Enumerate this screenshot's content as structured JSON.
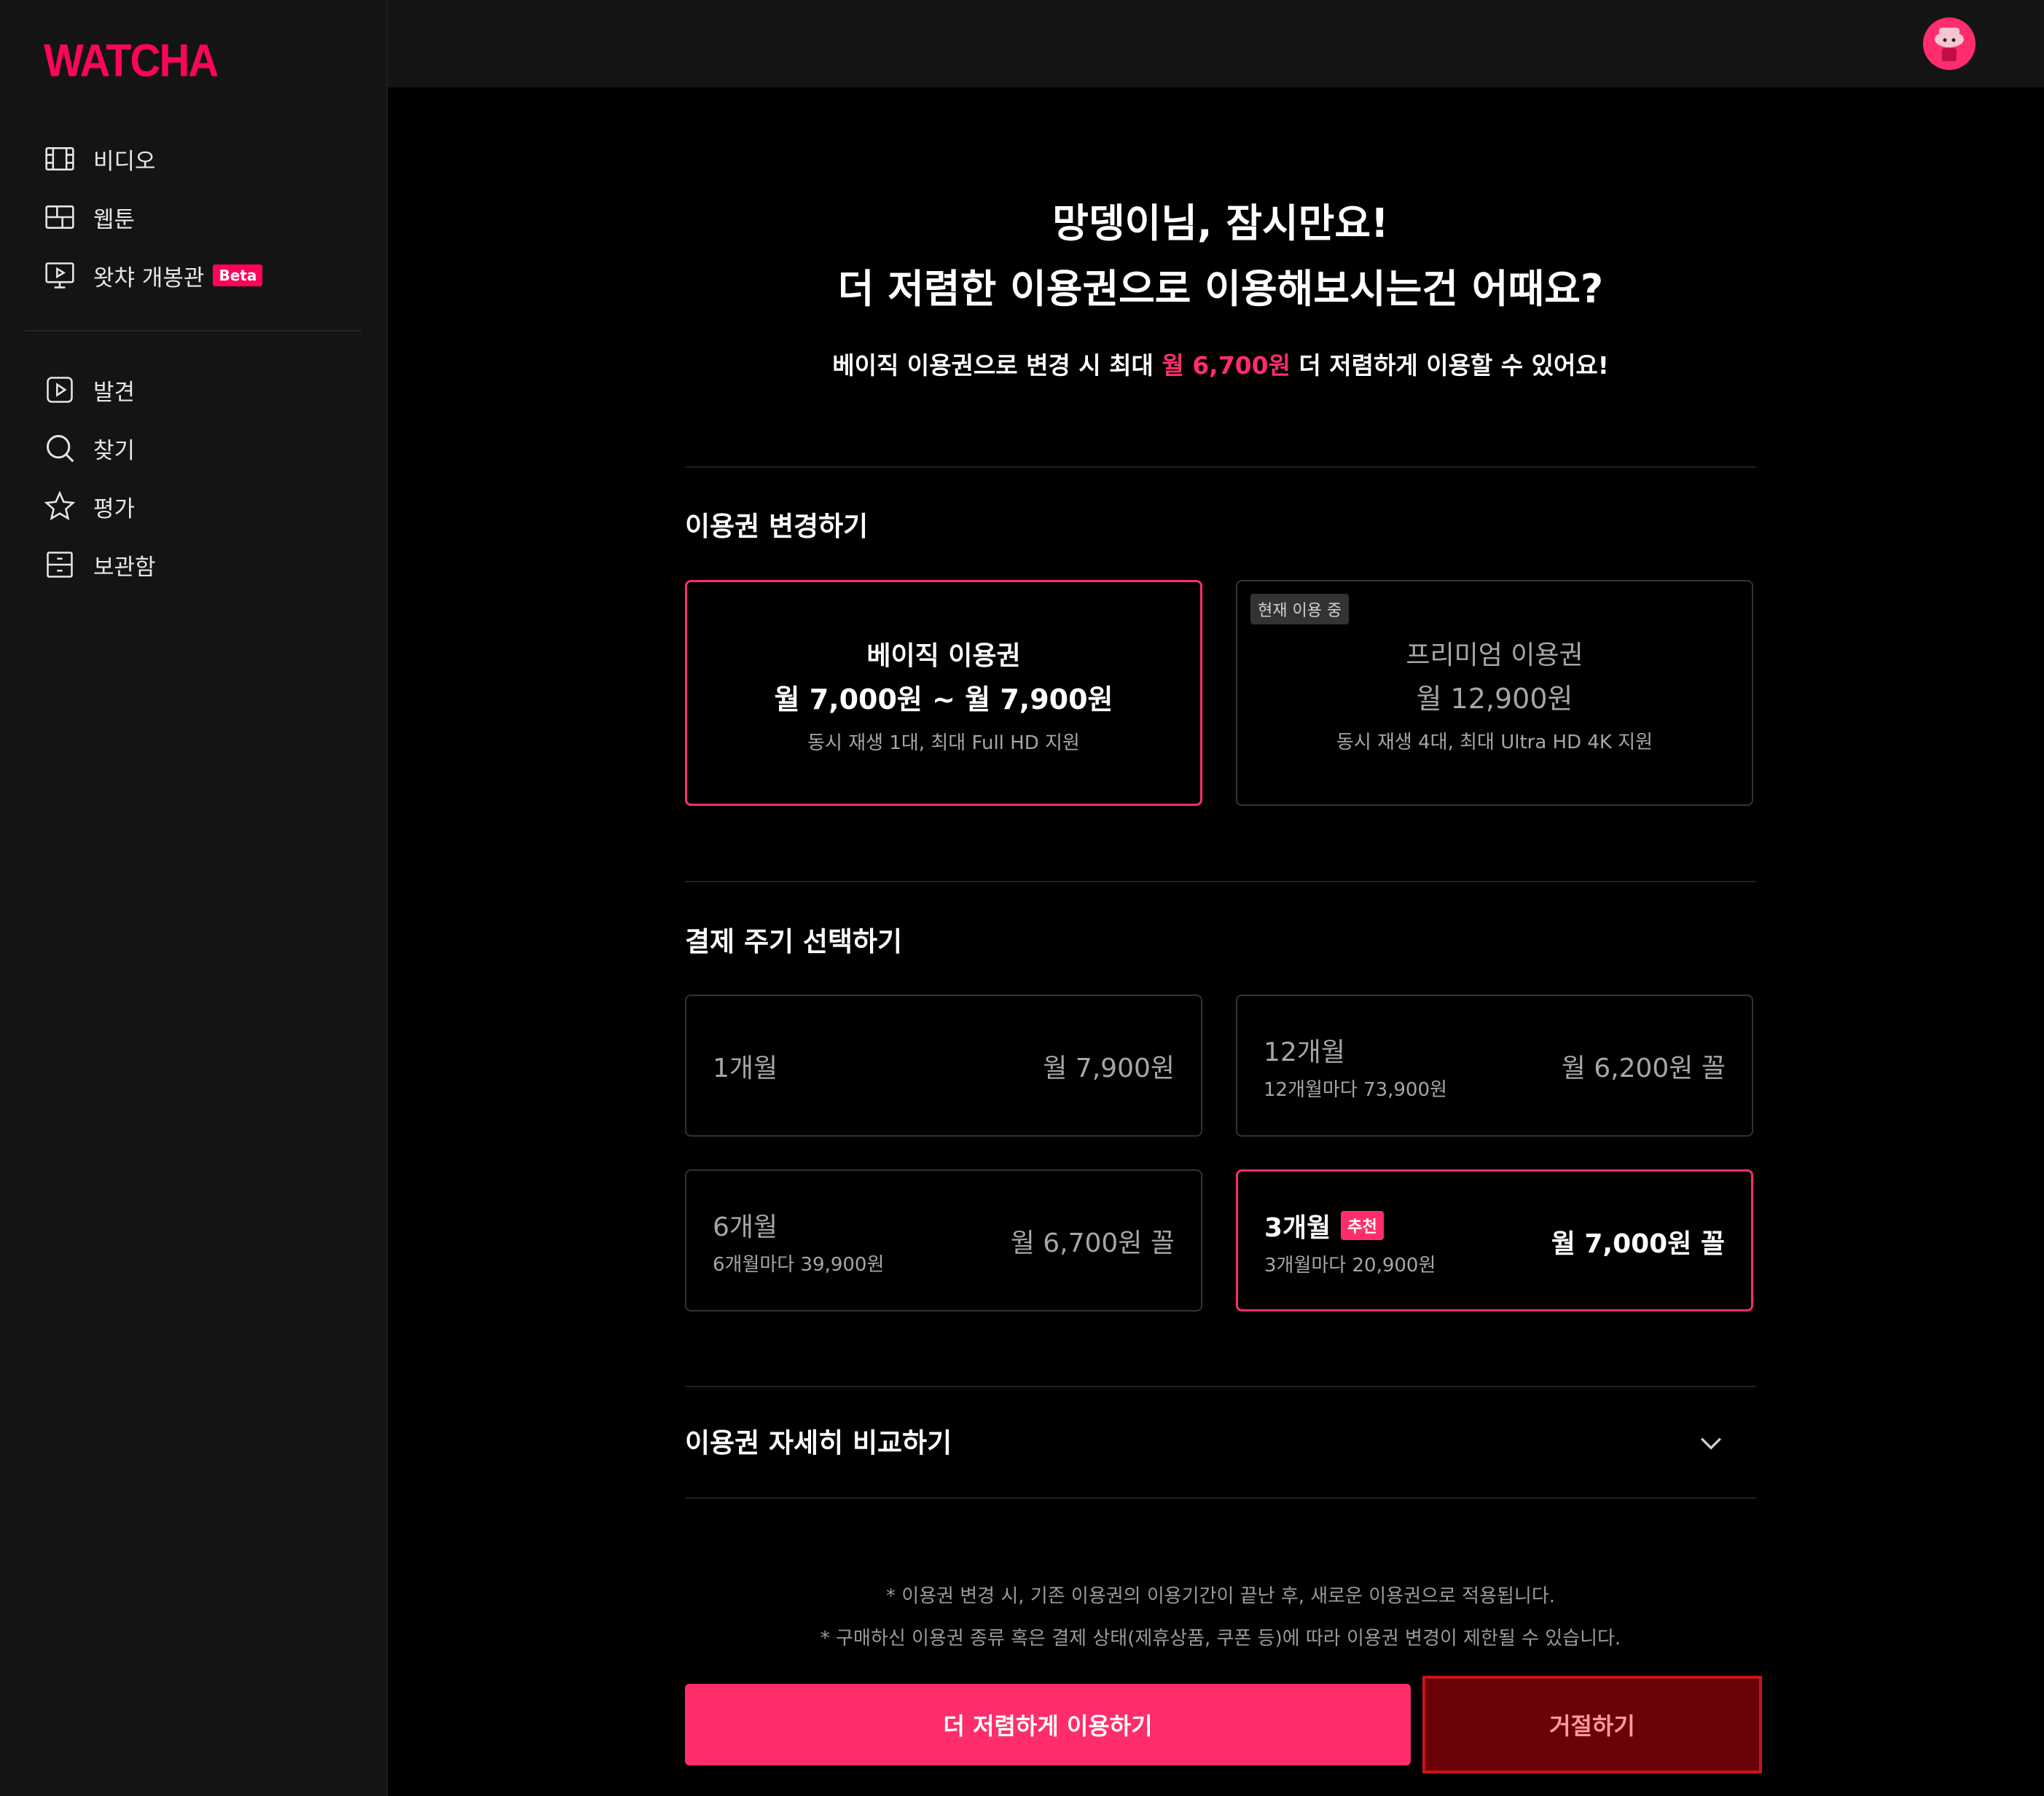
{
  "brand": {
    "logo": "WATCHA"
  },
  "sidebar": {
    "items": [
      {
        "label": "비디오",
        "icon": "film-icon"
      },
      {
        "label": "웹툰",
        "icon": "webtoon-icon"
      },
      {
        "label": "왓챠 개봉관",
        "icon": "monitor-icon",
        "badge": "Beta"
      },
      {
        "label": "발견",
        "icon": "play-square-icon"
      },
      {
        "label": "찾기",
        "icon": "search-icon"
      },
      {
        "label": "평가",
        "icon": "star-icon"
      },
      {
        "label": "보관함",
        "icon": "archive-icon"
      }
    ]
  },
  "header": {
    "title_line1": "망뎅이님, 잠시만요!",
    "title_line2": "더 저렴한 이용권으로 이용해보시는건 어때요?",
    "subtitle_prefix": "베이직 이용권으로 변경 시 최대 ",
    "subtitle_highlight": "월 6,700원",
    "subtitle_suffix": " 더 저렴하게 이용할 수 있어요!"
  },
  "plan_section": {
    "title": "이용권 변경하기",
    "plans": [
      {
        "name": "베이직 이용권",
        "price": "월 7,000원 ~ 월 7,900원",
        "desc": "동시 재생 1대, 최대 Full HD 지원",
        "selected": true
      },
      {
        "name": "프리미엄 이용권",
        "price": "월 12,900원",
        "desc": "동시 재생 4대, 최대 Ultra HD 4K 지원",
        "badge": "현재 이용 중",
        "selected": false
      }
    ]
  },
  "cycle_section": {
    "title": "결제 주기 선택하기",
    "options": [
      {
        "label": "1개월",
        "price": "월 7,900원",
        "sub": ""
      },
      {
        "label": "12개월",
        "sub": "12개월마다 73,900원",
        "price": "월 6,200원 꼴"
      },
      {
        "label": "6개월",
        "sub": "6개월마다 39,900원",
        "price": "월 6,700원 꼴"
      },
      {
        "label": "3개월",
        "badge": "추천",
        "sub": "3개월마다 20,900원",
        "price": "월 7,000원 꼴",
        "selected": true
      }
    ]
  },
  "compare": {
    "title": "이용권 자세히 비교하기"
  },
  "notices": [
    "* 이용권 변경 시, 기존 이용권의 이용기간이 끝난 후, 새로운 이용권으로 적용됩니다.",
    "* 구매하신 이용권 종류 혹은 결제 상태(제휴상품, 쿠폰 등)에 따라 이용권 변경이 제한될 수 있습니다."
  ],
  "actions": {
    "primary": "더 저렴하게 이용하기",
    "reject": "거절하기"
  },
  "colors": {
    "accent": "#ff2e6a",
    "reject_bg": "#6b0208",
    "reject_border": "#c8141c"
  }
}
